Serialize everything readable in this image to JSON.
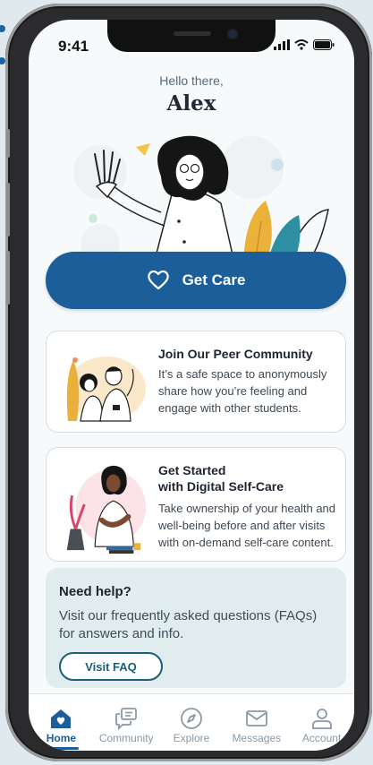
{
  "status_bar": {
    "time": "9:41"
  },
  "header": {
    "greeting": "Hello there,",
    "user_name": "Alex"
  },
  "primary_action": {
    "label": "Get Care",
    "icon": "heart-icon"
  },
  "cards": [
    {
      "title": "Join Our Peer Community",
      "description": "It’s a safe space to anonymously share how you’re feeling and engage with other students."
    },
    {
      "title_line1": "Get Started",
      "title_line2": "with Digital Self-Care",
      "description": "Take ownership of your health and well-being before and after visits with on-demand self-care content."
    }
  ],
  "help": {
    "title": "Need help?",
    "description": "Visit our frequently asked questions (FAQs) for answers and info.",
    "button_label": "Visit FAQ"
  },
  "tabs": [
    {
      "label": "Home",
      "icon": "home-icon",
      "active": true
    },
    {
      "label": "Community",
      "icon": "chat-bubbles-icon",
      "active": false
    },
    {
      "label": "Explore",
      "icon": "compass-icon",
      "active": false
    },
    {
      "label": "Messages",
      "icon": "envelope-icon",
      "active": false
    },
    {
      "label": "Account",
      "icon": "person-icon",
      "active": false
    }
  ],
  "colors": {
    "primary": "#1b5e9a",
    "teal": "#1b5e75",
    "help_bg": "#e0ecee",
    "background": "#f7fafb"
  }
}
